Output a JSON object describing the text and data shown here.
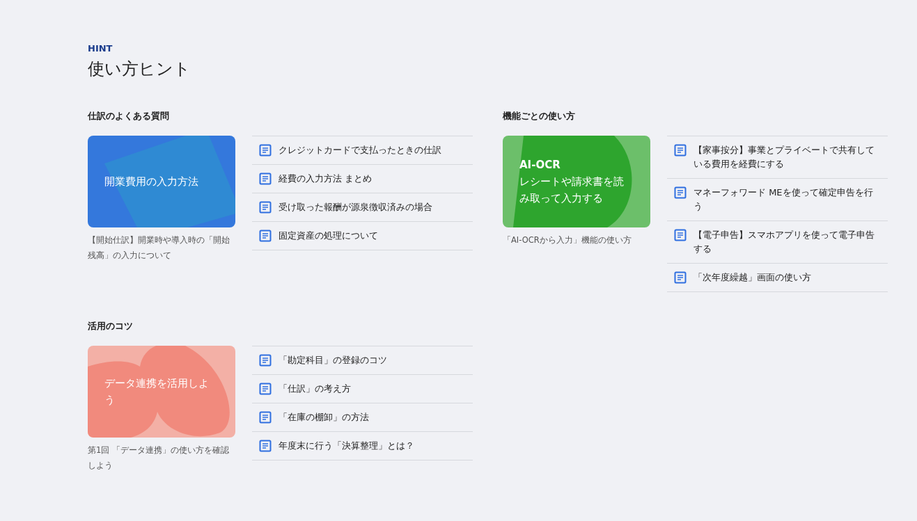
{
  "eyebrow": "HINT",
  "title": "使い方ヒント",
  "sections": [
    {
      "heading": "仕訳のよくある質問",
      "card": {
        "kind": "blue",
        "title": "開業費用の入力方法",
        "caption": "【開始仕訳】開業時や導入時の「開始残高」の入力について"
      },
      "articles": [
        "クレジットカードで支払ったときの仕訳",
        "経費の入力方法 まとめ",
        "受け取った報酬が源泉徴収済みの場合",
        "固定資産の処理について"
      ]
    },
    {
      "heading": "機能ごとの使い方",
      "card": {
        "kind": "green",
        "label": "AI-OCR",
        "title": "レシートや請求書を読み取って入力する",
        "caption": "「AI-OCRから入力」機能の使い方"
      },
      "articles": [
        "【家事按分】事業とプライベートで共有している費用を経費にする",
        "マネーフォワード MEを使って確定申告を行う",
        "【電子申告】スマホアプリを使って電子申告する",
        "「次年度繰越」画面の使い方"
      ]
    },
    {
      "heading": "活用のコツ",
      "card": {
        "kind": "red",
        "title": "データ連携を活用しよう",
        "caption": "第1回 「データ連携」の使い方を確認しよう"
      },
      "articles": [
        "「勘定科目」の登録のコツ",
        "「仕訳」の考え方",
        "「在庫の棚卸」の方法",
        "年度末に行う「決算整理」とは？"
      ]
    }
  ]
}
